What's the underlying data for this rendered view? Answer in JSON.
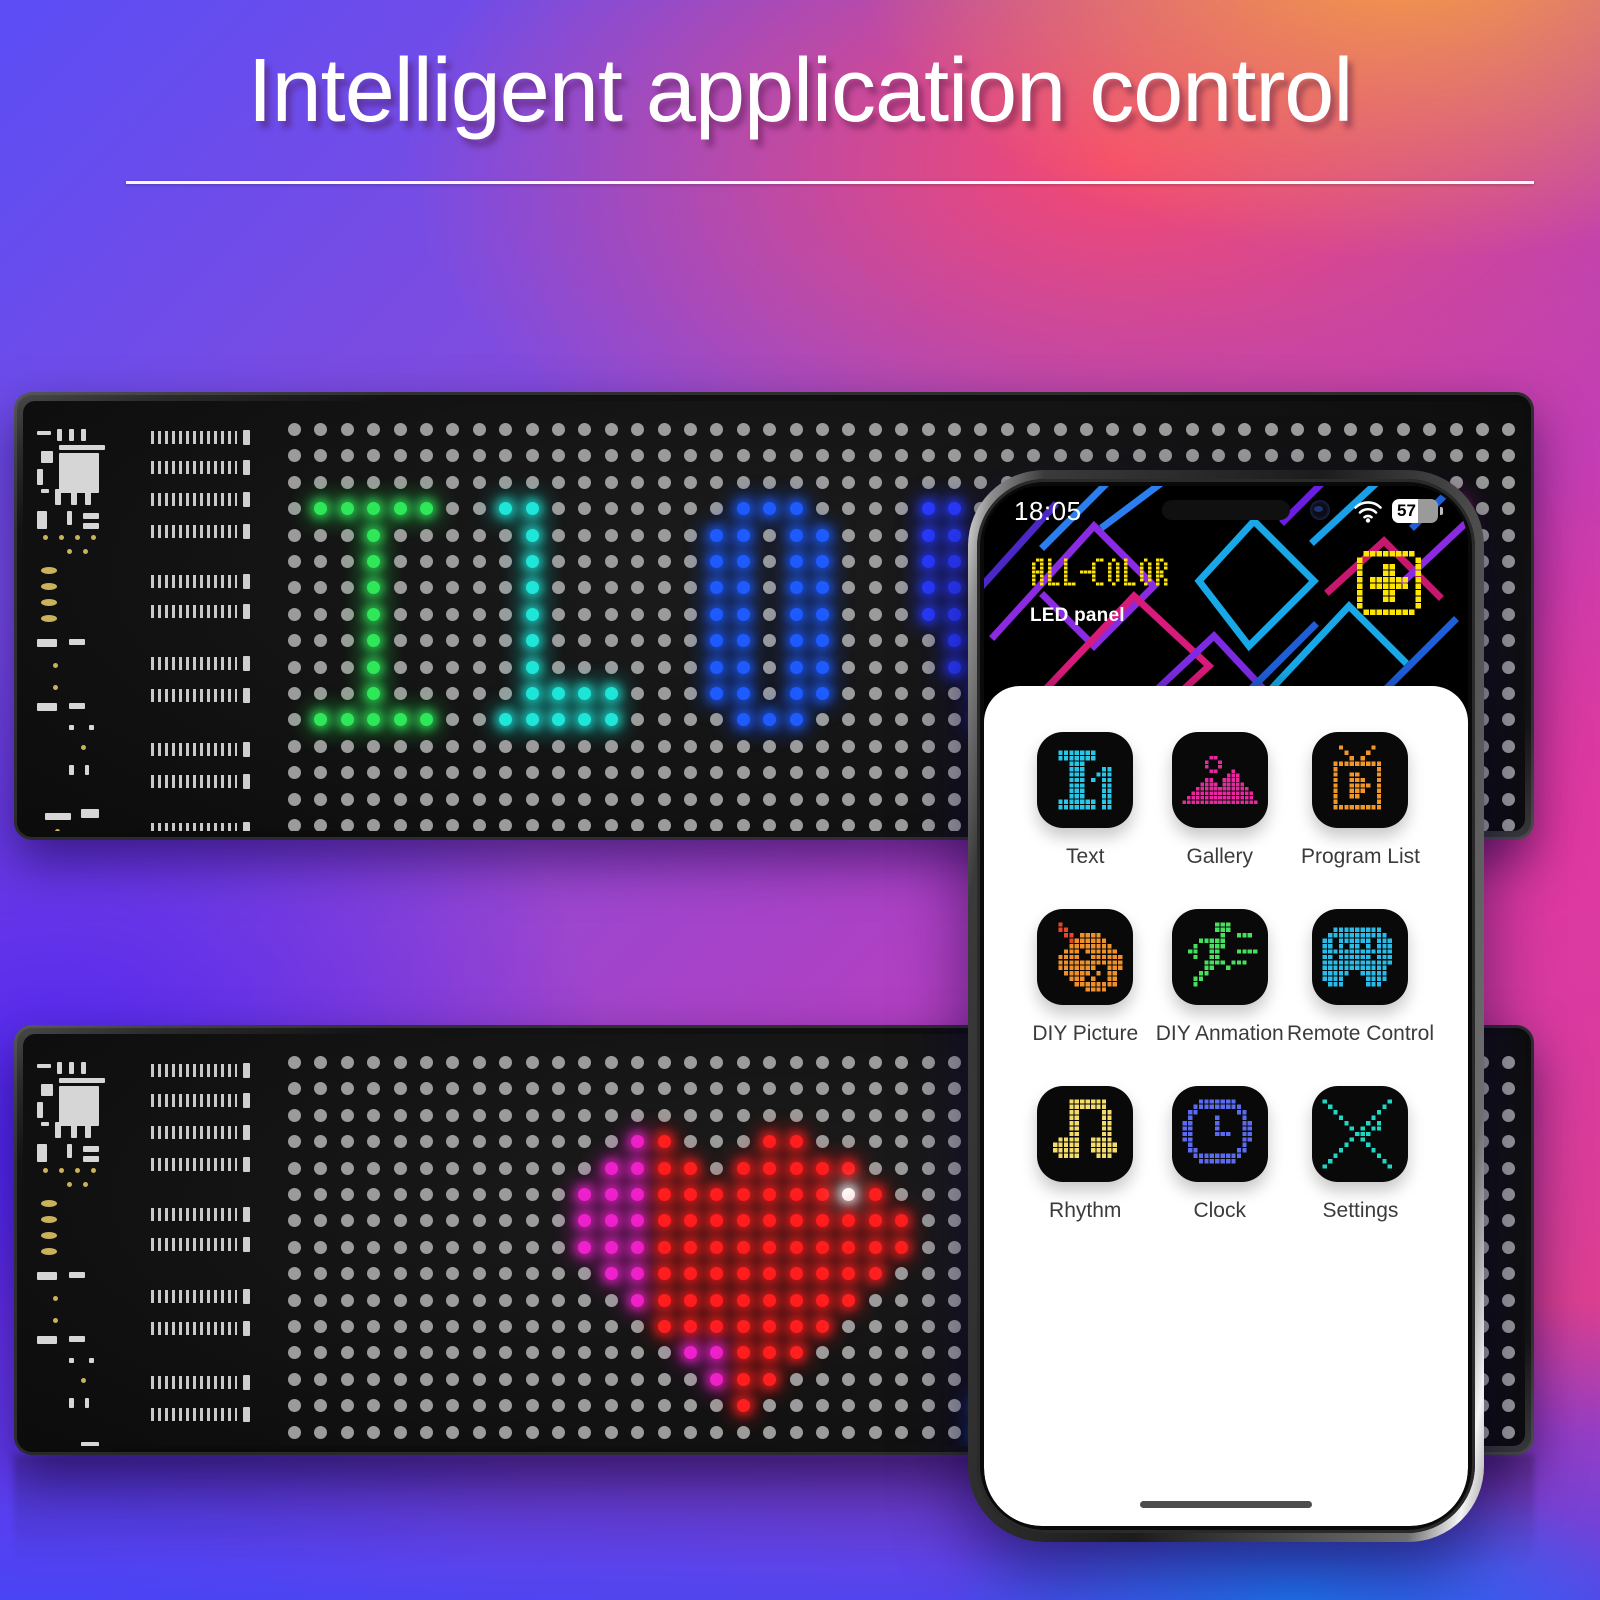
{
  "page": {
    "title": "Intelligent application control"
  },
  "led_panels": {
    "top": {
      "name": "led-panel-top",
      "display_text": "I LOVE Y",
      "letter_colors": [
        "#2fe85a",
        "#1fe6d8",
        "#1f5cff",
        "#2a3cff",
        "#a832f5",
        "#ee2fd6"
      ]
    },
    "bottom": {
      "name": "led-panel-bottom",
      "content": "heart and pixel character artwork",
      "heart_colors": [
        "#ff1f1f",
        "#ee22cc"
      ],
      "character_colors": [
        "#1f5cff",
        "#ffffff",
        "#ff1f3c",
        "#ee22cc"
      ]
    }
  },
  "phone": {
    "status_bar": {
      "time": "18:05",
      "wifi_icon": "wifi-icon",
      "battery_percent": "57"
    },
    "brand": {
      "logo_text": "ALL-COLOR",
      "subtitle": "LED panel",
      "logo_color": "#ffe600"
    },
    "add_button": {
      "icon": "plus-square-icon",
      "color": "#ffe600"
    },
    "apps": [
      {
        "label": "Text",
        "icon": "text-icon",
        "color": "#29c6e8"
      },
      {
        "label": "Gallery",
        "icon": "gallery-icon",
        "color": "#e8289e"
      },
      {
        "label": "Program List",
        "icon": "program-list-icon",
        "color": "#f2962a"
      },
      {
        "label": "DIY Picture",
        "icon": "palette-icon",
        "color": "#f0902a"
      },
      {
        "label": "DIY Anmation",
        "icon": "running-figure-icon",
        "color": "#46df5e"
      },
      {
        "label": "Remote Control",
        "icon": "gamepad-icon",
        "color": "#2bbbe8"
      },
      {
        "label": "Rhythm",
        "icon": "music-note-icon",
        "color": "#f2dc6a"
      },
      {
        "label": "Clock",
        "icon": "clock-icon",
        "color": "#5a6bf0"
      },
      {
        "label": "Settings",
        "icon": "tools-cross-icon",
        "color": "#1fd8c4"
      }
    ]
  },
  "colors": {
    "background_start": "#5b4df5",
    "background_mid": "#b53fc0",
    "background_end": "#fba03c",
    "title_color": "#ffffff"
  }
}
